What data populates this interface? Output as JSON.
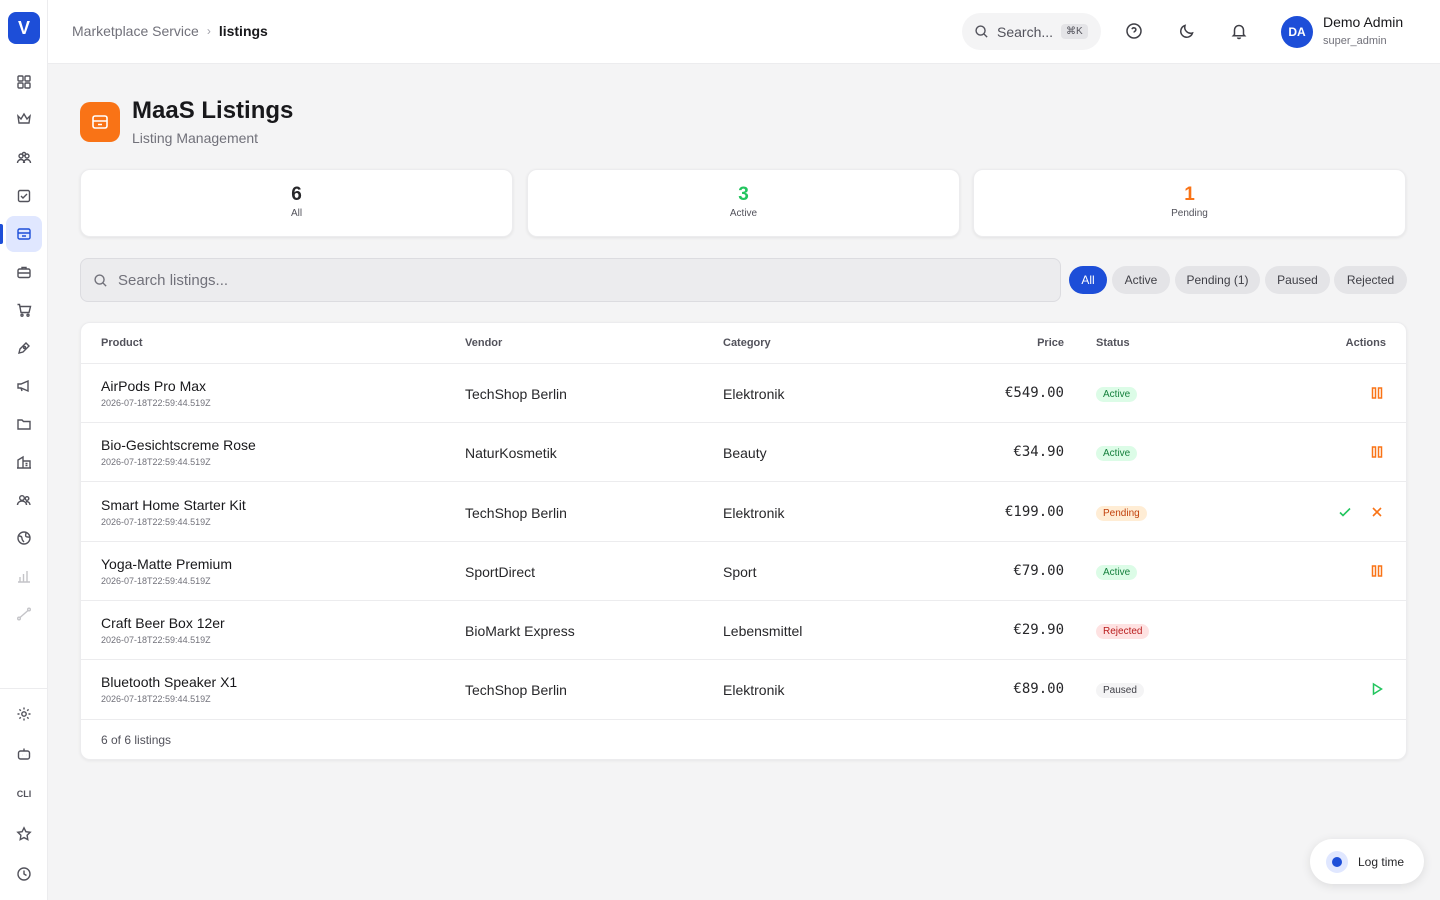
{
  "app": {
    "logo_letter": "V"
  },
  "breadcrumb": {
    "root": "Marketplace Service",
    "current": "listings"
  },
  "topbar": {
    "search_label": "Search...",
    "search_shortcut": "⌘K"
  },
  "user": {
    "initials": "DA",
    "name": "Demo Admin",
    "role": "super_admin"
  },
  "header": {
    "title": "MaaS Listings",
    "subtitle": "Listing Management"
  },
  "stats": [
    {
      "value": "6",
      "label": "All",
      "color": "#27272a"
    },
    {
      "value": "3",
      "label": "Active",
      "color": "#22c55e"
    },
    {
      "value": "1",
      "label": "Pending",
      "color": "#f97316"
    }
  ],
  "search": {
    "placeholder": "Search listings..."
  },
  "filters": [
    "All",
    "Active",
    "Pending (1)",
    "Paused",
    "Rejected"
  ],
  "table": {
    "columns": {
      "product": "Product",
      "vendor": "Vendor",
      "category": "Category",
      "price": "Price",
      "status": "Status",
      "actions": "Actions"
    },
    "rows": [
      {
        "name": "AirPods Pro Max",
        "date": "2026-07-18T22:59:44.519Z",
        "vendor": "TechShop Berlin",
        "category": "Elektronik",
        "price": "€549.00",
        "status": "Active",
        "actions": [
          "pause-icon"
        ]
      },
      {
        "name": "Bio-Gesichtscreme Rose",
        "date": "2026-07-18T22:59:44.519Z",
        "vendor": "NaturKosmetik",
        "category": "Beauty",
        "price": "€34.90",
        "status": "Active",
        "actions": [
          "pause-icon"
        ]
      },
      {
        "name": "Smart Home Starter Kit",
        "date": "2026-07-18T22:59:44.519Z",
        "vendor": "TechShop Berlin",
        "category": "Elektronik",
        "price": "€199.00",
        "status": "Pending",
        "actions": [
          "check-icon",
          "close-icon"
        ]
      },
      {
        "name": "Yoga-Matte Premium",
        "date": "2026-07-18T22:59:44.519Z",
        "vendor": "SportDirect",
        "category": "Sport",
        "price": "€79.00",
        "status": "Active",
        "actions": [
          "pause-icon"
        ]
      },
      {
        "name": "Craft Beer Box 12er",
        "date": "2026-07-18T22:59:44.519Z",
        "vendor": "BioMarkt Express",
        "category": "Lebensmittel",
        "price": "€29.90",
        "status": "Rejected",
        "actions": []
      },
      {
        "name": "Bluetooth Speaker X1",
        "date": "2026-07-18T22:59:44.519Z",
        "vendor": "TechShop Berlin",
        "category": "Elektronik",
        "price": "€89.00",
        "status": "Paused",
        "actions": [
          "play-icon"
        ]
      }
    ],
    "footer": "6 of 6 listings"
  },
  "log_time": {
    "label": "Log time"
  },
  "sidebar": {
    "cli_label": "CLI"
  },
  "colors": {
    "accent": "#1d4ed8",
    "brand_orange": "#f97316",
    "active_green": "#22c55e"
  }
}
